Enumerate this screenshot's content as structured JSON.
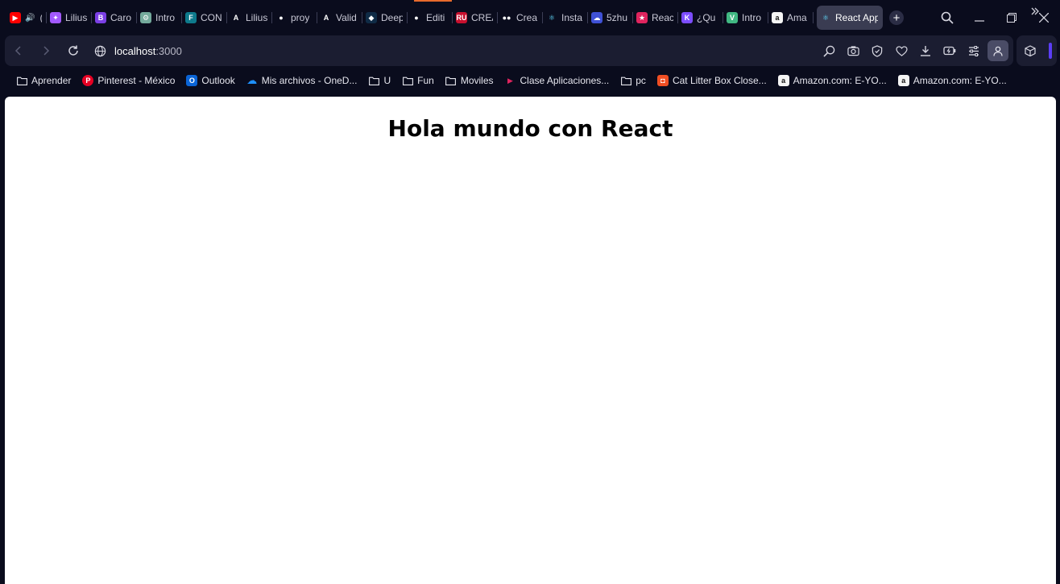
{
  "tabs": [
    {
      "label": "(",
      "icon": "youtube-icon",
      "color": "#ff0000",
      "audio": true
    },
    {
      "label": "Lilius",
      "icon": "figma-icon",
      "color": "#a259ff"
    },
    {
      "label": "Caro",
      "icon": "b-icon",
      "color": "#7b3fe4"
    },
    {
      "label": "Intro",
      "icon": "chatgpt-icon",
      "color": "#74aa9c"
    },
    {
      "label": "CON",
      "icon": "f-icon",
      "color": "#0e7a8c"
    },
    {
      "label": "Lilius",
      "icon": "a-icon",
      "color": "#ffffff"
    },
    {
      "label": "proy",
      "icon": "github-icon",
      "color": "#ffffff"
    },
    {
      "label": "Valid",
      "icon": "a-icon",
      "color": "#ffffff"
    },
    {
      "label": "Deep",
      "icon": "deepl-icon",
      "color": "#0f2b46"
    },
    {
      "label": "Editi",
      "icon": "github-icon",
      "color": "#ffffff"
    },
    {
      "label": "CREA",
      "icon": "ru-icon",
      "color": "#c8102e"
    },
    {
      "label": "Crea",
      "icon": "medium-icon",
      "color": "#ffffff"
    },
    {
      "label": "Insta",
      "icon": "react-icon",
      "color": "#61dafb"
    },
    {
      "label": "5zhu",
      "icon": "cloud-icon",
      "color": "#3f51d6"
    },
    {
      "label": "Reac",
      "icon": "star-icon",
      "color": "#e0245e"
    },
    {
      "label": "¿Qu",
      "icon": "k-icon",
      "color": "#7c4dff"
    },
    {
      "label": "Intro",
      "icon": "vue-icon",
      "color": "#41b883"
    },
    {
      "label": "Ama",
      "icon": "amazon-icon",
      "color": "#ffffff"
    },
    {
      "label": "React App",
      "icon": "react-icon",
      "color": "#61dafb",
      "active": true
    }
  ],
  "address": {
    "host": "localhost",
    "port": ":3000"
  },
  "bookmarks": [
    {
      "label": "Aprender",
      "icon": "folder-icon"
    },
    {
      "label": "Pinterest - México",
      "icon": "pinterest-icon",
      "color": "#e60023"
    },
    {
      "label": "Outlook",
      "icon": "outlook-icon",
      "color": "#0a64d6"
    },
    {
      "label": "Mis archivos - OneD...",
      "icon": "onedrive-icon",
      "color": "#1e90ff"
    },
    {
      "label": "U",
      "icon": "folder-icon"
    },
    {
      "label": "Fun",
      "icon": "folder-icon"
    },
    {
      "label": "Moviles",
      "icon": "folder-icon"
    },
    {
      "label": "Clase Aplicaciones...",
      "icon": "play-icon",
      "color": "#e0245e"
    },
    {
      "label": "pc",
      "icon": "folder-icon"
    },
    {
      "label": "Cat Litter Box Close...",
      "icon": "shop-icon",
      "color": "#f04e23"
    },
    {
      "label": "Amazon.com: E-YO...",
      "icon": "amazon-icon",
      "color": "#ffffff"
    },
    {
      "label": "Amazon.com: E-YO...",
      "icon": "amazon-icon",
      "color": "#ffffff"
    }
  ],
  "page": {
    "heading": "Hola mundo con React"
  },
  "colors": {
    "chrome_bg": "#0a0c1d",
    "toolbar_bg": "#1b1d31",
    "active_tab": "#3a3c52",
    "accent": "#5b3df5",
    "tab_indicator": "#e86a2c"
  }
}
